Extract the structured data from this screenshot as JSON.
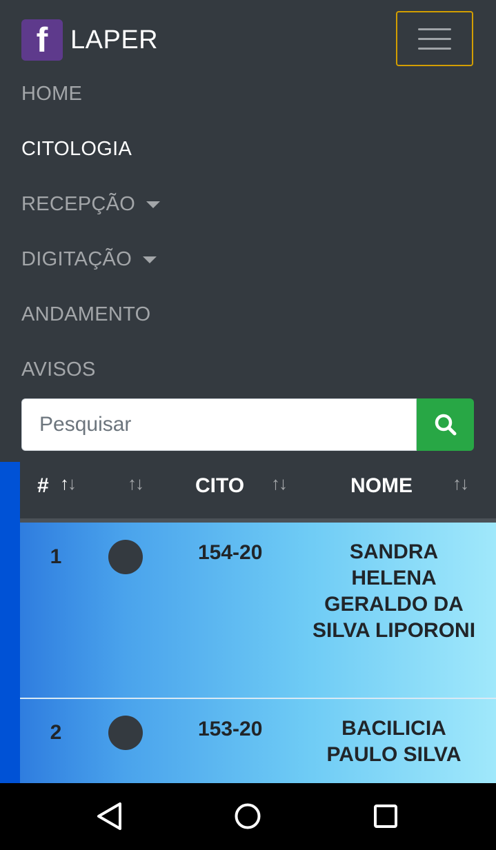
{
  "brand": {
    "logo_letter": "f",
    "name": "LAPER",
    "logo_color": "#5e3a8c"
  },
  "nav": {
    "items": [
      {
        "label": "HOME",
        "active": false,
        "dropdown": false
      },
      {
        "label": "CITOLOGIA",
        "active": true,
        "dropdown": false
      },
      {
        "label": "RECEPÇÃO",
        "active": false,
        "dropdown": true
      },
      {
        "label": "DIGITAÇÃO",
        "active": false,
        "dropdown": true
      },
      {
        "label": "ANDAMENTO",
        "active": false,
        "dropdown": false
      },
      {
        "label": "AVISOS",
        "active": false,
        "dropdown": false
      }
    ]
  },
  "search": {
    "placeholder": "Pesquisar",
    "value": "",
    "icon": "search-icon",
    "button_color": "#28a745"
  },
  "table": {
    "headers": [
      "#",
      "",
      "CITO",
      "NOME"
    ],
    "rows": [
      {
        "num": "1",
        "cito": "154-20",
        "nome": "SANDRA HELENA GERALDO DA SILVA LIPORONI"
      },
      {
        "num": "2",
        "cito": "153-20",
        "nome": "BACILICIA PAULO SILVA"
      }
    ]
  },
  "colors": {
    "navbar": "#343a40",
    "accent_border": "#d39e00"
  },
  "system_nav": {
    "back": "back-icon",
    "home": "home-icon",
    "recents": "recents-icon"
  }
}
